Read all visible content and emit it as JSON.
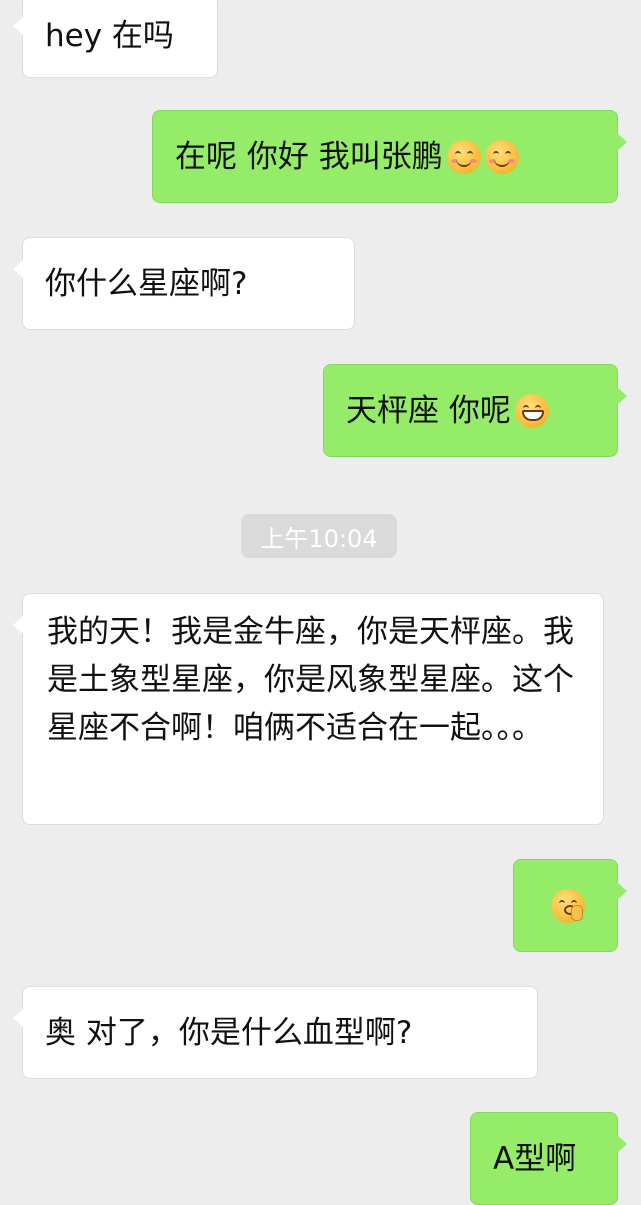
{
  "messages": [
    {
      "side": "in",
      "text": "hey 在吗"
    },
    {
      "side": "out",
      "text": "在呢 你好 我叫张鹏",
      "emoji": [
        "smile-emoji",
        "smile-emoji"
      ]
    },
    {
      "side": "in",
      "text": "你什么星座啊?"
    },
    {
      "side": "out",
      "text": "天枰座 你呢",
      "emoji": [
        "grin-emoji"
      ]
    },
    {
      "side": "in",
      "text": "我的天！我是金牛座，你是天枰座。我是土象型星座，你是风象型星座。这个星座不合啊！咱俩不适合在一起。。。"
    },
    {
      "side": "out",
      "text": "",
      "emoji": [
        "shushing-emoji"
      ]
    },
    {
      "side": "in",
      "text": "奥 对了，你是什么血型啊?"
    },
    {
      "side": "out",
      "text": "A型啊"
    }
  ],
  "timestamp": "上午10:04",
  "colors": {
    "background": "#ededed",
    "incoming_bubble": "#ffffff",
    "outgoing_bubble": "#95ec69",
    "timestamp_bg": "#dadada"
  }
}
